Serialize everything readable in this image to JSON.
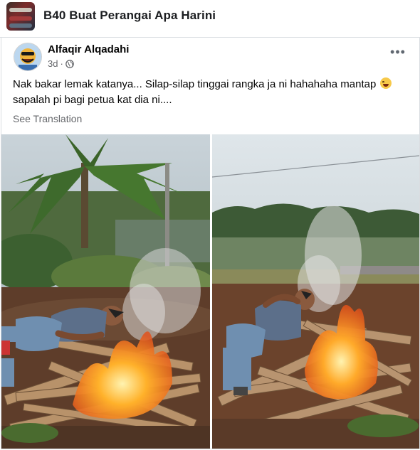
{
  "group": {
    "name": "B40 Buat Perangai Apa Harini"
  },
  "post": {
    "author": "Alfaqir Alqadahi",
    "time": "3d",
    "privacy_icon": "globe-icon",
    "more_icon": "more-options-icon",
    "more_label": "•••",
    "text_line1": "Nak bakar lemak katanya... Silap-silap tinggai rangka ja ni hahahaha mantap",
    "text_line2": "sapalah pi bagi petua kat dia ni....",
    "emoji": "laughing-face-emoji",
    "see_translation": "See Translation"
  },
  "photos": [
    {
      "name": "photo-left",
      "description_icon": "man-lying-on-burning-woodpile"
    },
    {
      "name": "photo-right",
      "description_icon": "man-lying-on-burning-woodpile"
    }
  ],
  "colors": {
    "text": "#050505",
    "secondary": "#65676b",
    "divider": "#dadde1"
  }
}
